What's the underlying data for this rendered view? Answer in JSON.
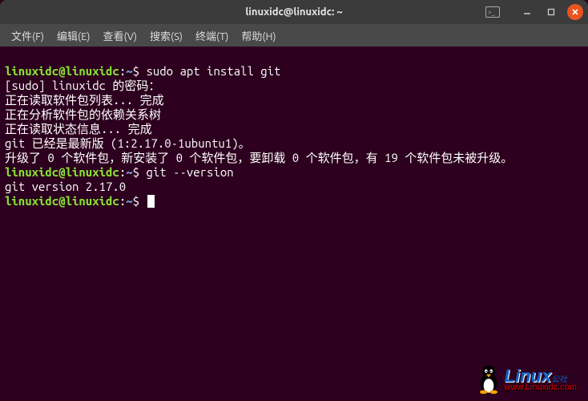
{
  "titlebar": {
    "title": "linuxidc@linuxidc: ~"
  },
  "menubar": {
    "items": [
      "文件(F)",
      "编辑(E)",
      "查看(V)",
      "搜索(S)",
      "终端(T)",
      "帮助(H)"
    ]
  },
  "prompt": {
    "userhost": "linuxidc@linuxidc",
    "colon": ":",
    "path": "~",
    "dollar": "$"
  },
  "lines": [
    {
      "type": "cmd",
      "text": "sudo apt install git"
    },
    {
      "type": "out",
      "text": "[sudo] linuxidc 的密码："
    },
    {
      "type": "out",
      "text": "正在读取软件包列表... 完成"
    },
    {
      "type": "out",
      "text": "正在分析软件包的依赖关系树"
    },
    {
      "type": "out",
      "text": "正在读取状态信息... 完成"
    },
    {
      "type": "out",
      "text": "git 已经是最新版 (1:2.17.0-1ubuntu1)。"
    },
    {
      "type": "out",
      "text": "升级了 0 个软件包，新安装了 0 个软件包，要卸载 0 个软件包，有 19 个软件包未被升级。"
    },
    {
      "type": "cmd",
      "text": "git --version"
    },
    {
      "type": "out",
      "text": "git version 2.17.0"
    },
    {
      "type": "cmd",
      "text": ""
    }
  ],
  "watermark": {
    "main": "Linux",
    "sub": "公社",
    "url": "www.Linuxidc.com"
  }
}
